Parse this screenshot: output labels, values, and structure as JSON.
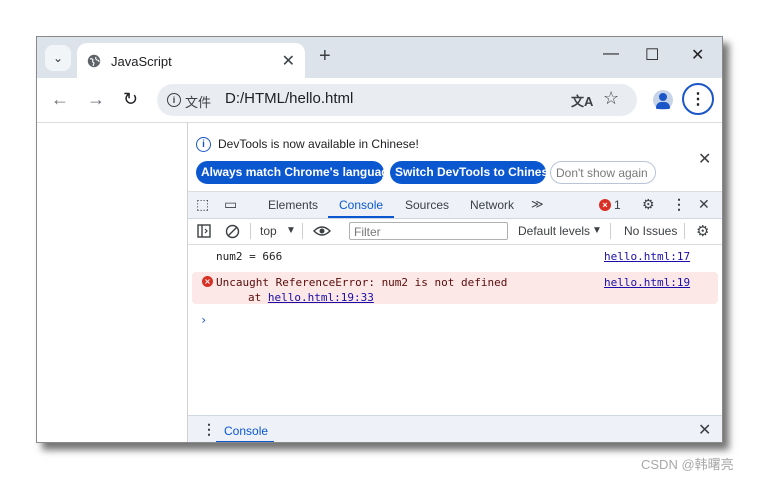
{
  "browser": {
    "tab": {
      "title": "JavaScript",
      "close": "✕"
    },
    "new_tab": "+",
    "window_controls": {
      "minimize": "—",
      "maximize": "☐",
      "close": "✕"
    },
    "tab_search": "⌄",
    "nav": {
      "back": "←",
      "forward": "→",
      "reload": "↻"
    },
    "address": {
      "info": "i",
      "scheme": "文件",
      "url": "D:/HTML/hello.html",
      "translate": "文A",
      "star": "☆"
    },
    "menu": "⋮"
  },
  "devtools": {
    "infobar": {
      "message": "DevTools is now available in Chinese!",
      "buttons": [
        "Always match Chrome's language",
        "Switch DevTools to Chinese",
        "Don't show again"
      ],
      "close": "✕"
    },
    "tabs": [
      "Elements",
      "Console",
      "Sources",
      "Network"
    ],
    "active_tab": "Console",
    "more_tabs": "≫",
    "error_count": "1",
    "icons": {
      "inspect": "⬚",
      "device": "▭",
      "settings": "⚙",
      "more": "⋮",
      "close": "✕"
    },
    "console_toolbar": {
      "context": "top",
      "filter_placeholder": "Filter",
      "levels": "Default levels",
      "issues": "No Issues"
    },
    "messages": [
      {
        "text": "num2 = 666",
        "source": "hello.html:17"
      },
      {
        "text": "Uncaught ReferenceError: num2 is not defined",
        "at_prefix": "at ",
        "at_link": "hello.html:19:33",
        "source": "hello.html:19",
        "level": "error"
      }
    ],
    "prompt": "›",
    "drawer": {
      "label": "Console",
      "close": "✕"
    }
  },
  "watermark": "CSDN @韩曙亮",
  "colors": {
    "accent": "#0b57d0",
    "error": "#d93025",
    "error_bg": "#fce8e6",
    "tabstrip": "#dde3ea"
  }
}
